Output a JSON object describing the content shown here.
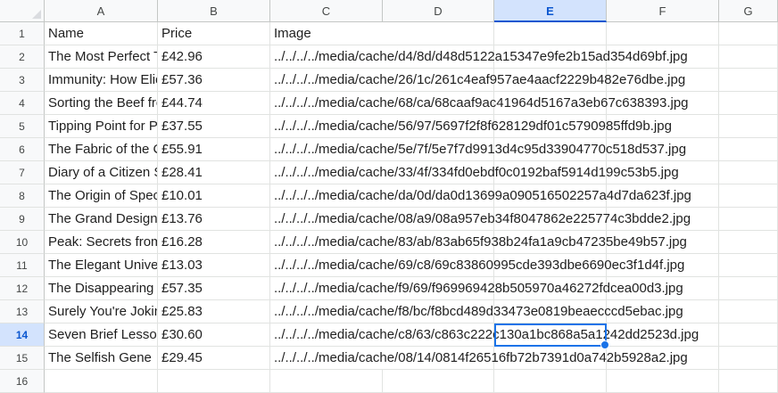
{
  "columns": [
    "A",
    "B",
    "C",
    "D",
    "E",
    "F",
    "G"
  ],
  "active_column": "E",
  "active_row": "14",
  "rows": [
    {
      "num": "1",
      "a": "Name",
      "b": "Price",
      "c": "Image"
    },
    {
      "num": "2",
      "a": "The Most Perfect Thing: Inside (and Outside) a Bird's Egg",
      "b": "£42.96",
      "c": "../../../../media/cache/d4/8d/d48d5122a15347e9fe2b15ad354d69bf.jpg"
    },
    {
      "num": "3",
      "a": "Immunity: How Elie Metchnikoff Changed the Course of Modern Medicine",
      "b": "£57.36",
      "c": "../../../../media/cache/26/1c/261c4eaf957ae4aacf2229b482e76dbe.jpg"
    },
    {
      "num": "4",
      "a": "Sorting the Beef from the Bull: The Science of Food Fraud Forensics",
      "b": "£44.74",
      "c": "../../../../media/cache/68/ca/68caaf9ac41964d5167a3eb67c638393.jpg"
    },
    {
      "num": "5",
      "a": "Tipping Point for Planet Earth",
      "b": "£37.55",
      "c": "../../../../media/cache/56/97/5697f2f8f628129df01c5790985ffd9b.jpg"
    },
    {
      "num": "6",
      "a": "The Fabric of the Cosmos: Space, Time, and the Texture of Reality",
      "b": "£55.91",
      "c": "../../../../media/cache/5e/7f/5e7f7d9913d4c95d33904770c518d537.jpg"
    },
    {
      "num": "7",
      "a": "Diary of a Citizen Scientist",
      "b": "£28.41",
      "c": "../../../../media/cache/33/4f/334fd0ebdf0c0192baf5914d199c53b5.jpg"
    },
    {
      "num": "8",
      "a": "The Origin of Species",
      "b": "£10.01",
      "c": "../../../../media/cache/da/0d/da0d13699a090516502257a4d7da623f.jpg"
    },
    {
      "num": "9",
      "a": "The Grand Design",
      "b": "£13.76",
      "c": "../../../../media/cache/08/a9/08a957eb34f8047862e225774c3bdde2.jpg"
    },
    {
      "num": "10",
      "a": "Peak: Secrets from the New Science of Expertise",
      "b": "£16.28",
      "c": "../../../../media/cache/83/ab/83ab65f938b24fa1a9cb47235be49b57.jpg"
    },
    {
      "num": "11",
      "a": "The Elegant Universe",
      "b": "£13.03",
      "c": "../../../../media/cache/69/c8/69c83860995cde393dbe6690ec3f1d4f.jpg"
    },
    {
      "num": "12",
      "a": "The Disappearing Spoon",
      "b": "£57.35",
      "c": "../../../../media/cache/f9/69/f969969428b505970a46272fdcea00d3.jpg"
    },
    {
      "num": "13",
      "a": "Surely You're Joking, Mr. Feynman!",
      "b": "£25.83",
      "c": "../../../../media/cache/f8/bc/f8bcd489d33473e0819beaecccd5ebac.jpg"
    },
    {
      "num": "14",
      "a": "Seven Brief Lessons on Physics",
      "b": "£30.60",
      "c": "../../../../media/cache/c8/63/c863c222c130a1bc868a5a1242dd2523d.jpg"
    },
    {
      "num": "15",
      "a": "The Selfish Gene",
      "b": "£29.45",
      "c": "../../../../media/cache/08/14/0814f26516fb72b7391d0a742b5928a2.jpg"
    },
    {
      "num": "16",
      "a": "",
      "b": "",
      "c": ""
    }
  ]
}
